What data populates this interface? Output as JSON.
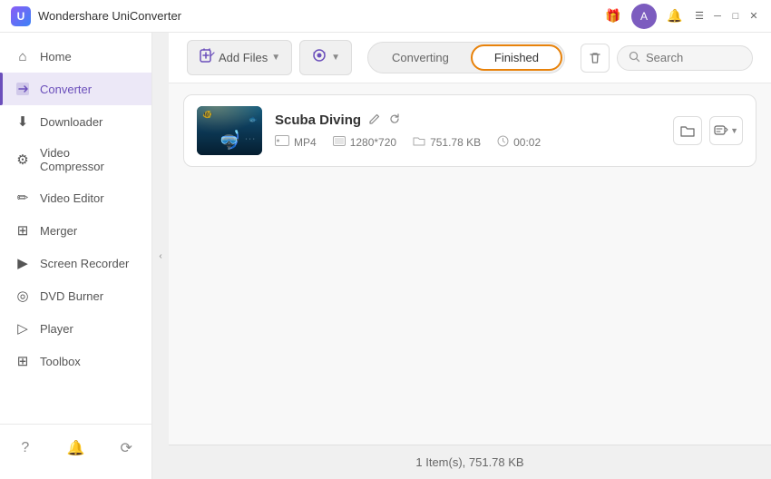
{
  "app": {
    "title": "Wondershare UniConverter",
    "logo_color": "#6b4fbb"
  },
  "titlebar": {
    "gift_icon": "🎁",
    "user_initial": "A",
    "bell_icon": "🔔",
    "menu_icon": "☰",
    "minimize_icon": "─",
    "maximize_icon": "□",
    "close_icon": "✕"
  },
  "sidebar": {
    "items": [
      {
        "id": "home",
        "label": "Home",
        "icon": "⌂"
      },
      {
        "id": "converter",
        "label": "Converter",
        "icon": "⟳",
        "active": true
      },
      {
        "id": "downloader",
        "label": "Downloader",
        "icon": "⬇"
      },
      {
        "id": "video-compressor",
        "label": "Video Compressor",
        "icon": "⚙"
      },
      {
        "id": "video-editor",
        "label": "Video Editor",
        "icon": "✏"
      },
      {
        "id": "merger",
        "label": "Merger",
        "icon": "⊞"
      },
      {
        "id": "screen-recorder",
        "label": "Screen Recorder",
        "icon": "▶"
      },
      {
        "id": "dvd-burner",
        "label": "DVD Burner",
        "icon": "◎"
      },
      {
        "id": "player",
        "label": "Player",
        "icon": "▷"
      },
      {
        "id": "toolbox",
        "label": "Toolbox",
        "icon": "⊞"
      }
    ],
    "bottom": {
      "help_icon": "?",
      "bell_icon": "🔔",
      "refresh_icon": "⟳"
    },
    "collapse_icon": "‹"
  },
  "toolbar": {
    "add_files_label": "Add Files",
    "add_files_icon": "📄",
    "add_dropdown_icon": "▼",
    "screenshot_label": "",
    "screenshot_icon": "📷",
    "tab_converting": "Converting",
    "tab_finished": "Finished",
    "active_tab": "finished",
    "search_placeholder": "Search",
    "trash_icon": "🗑"
  },
  "file_list": {
    "items": [
      {
        "id": "scuba-diving",
        "title": "Scuba Diving",
        "edit_icon": "✏",
        "refresh_icon": "⟳",
        "format": "MP4",
        "resolution": "1280*720",
        "size": "751.78 KB",
        "duration": "00:02",
        "folder_icon": "🗂",
        "more_icon": "💬"
      }
    ]
  },
  "status_bar": {
    "text": "1 Item(s), 751.78 KB"
  }
}
